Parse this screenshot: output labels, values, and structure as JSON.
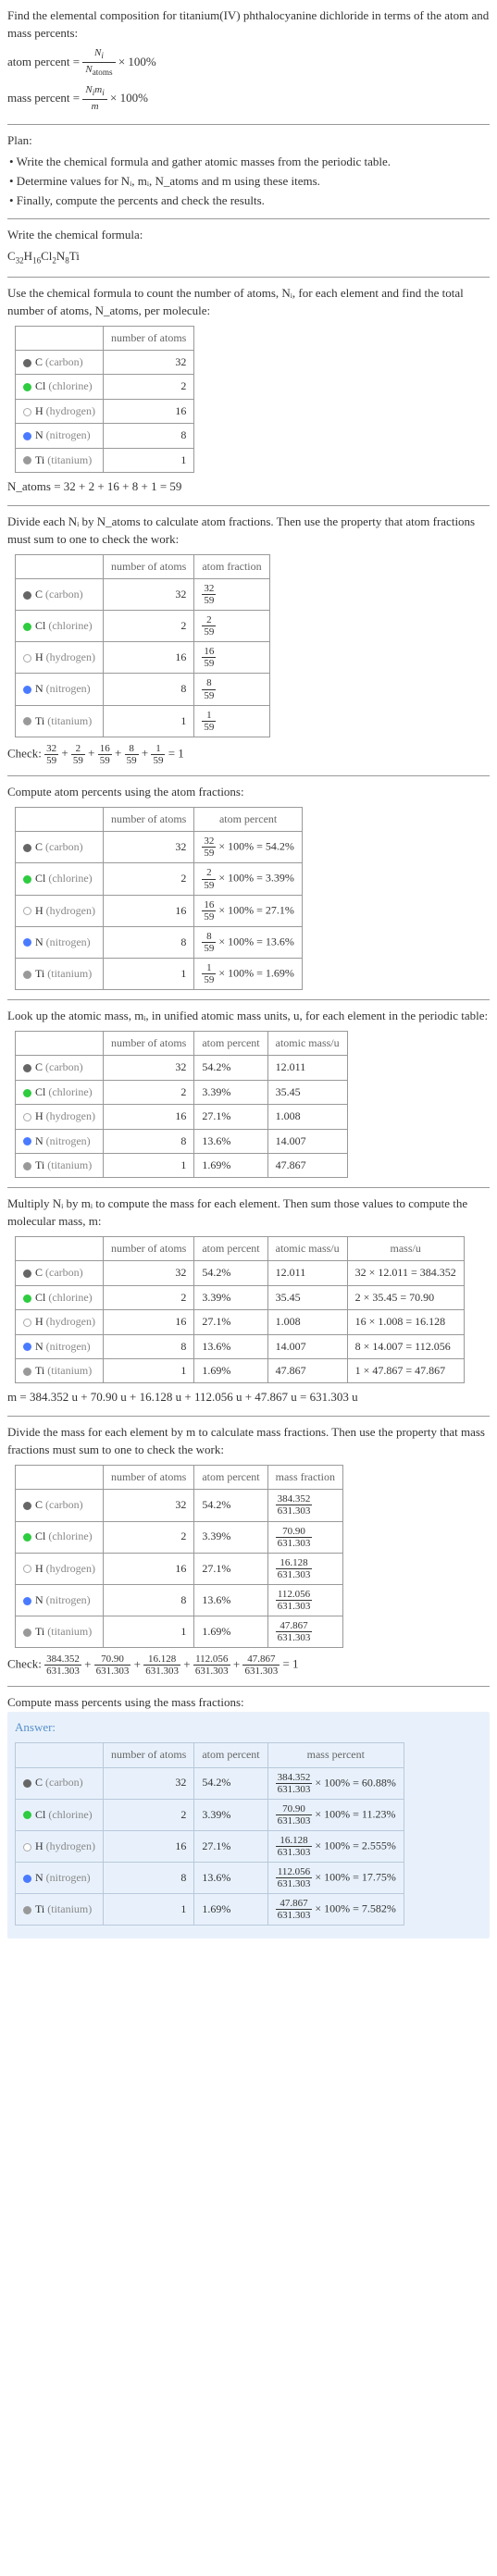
{
  "intro": "Find the elemental composition for titanium(IV) phthalocyanine dichloride in terms of the atom and mass percents:",
  "atom_percent_label": "atom percent",
  "mass_percent_label": "mass percent",
  "times_100": "× 100%",
  "plan_title": "Plan:",
  "plan_items": [
    "• Write the chemical formula and gather atomic masses from the periodic table.",
    "• Determine values for Nᵢ, mᵢ, N_atoms and m using these items.",
    "• Finally, compute the percents and check the results."
  ],
  "write_formula_label": "Write the chemical formula:",
  "chem_formula_parts": [
    "C",
    "32",
    "H",
    "16",
    "Cl",
    "2",
    "N",
    "8",
    "Ti"
  ],
  "use_formula_text": "Use the chemical formula to count the number of atoms, Nᵢ, for each element and find the total number of atoms, N_atoms, per molecule:",
  "headers": {
    "num_atoms": "number of atoms",
    "atom_frac": "atom fraction",
    "atom_pct": "atom percent",
    "mass_u": "atomic mass/u",
    "mass": "mass/u",
    "mass_frac": "mass fraction",
    "mass_pct": "mass percent"
  },
  "elements": [
    {
      "dot": "dot-c",
      "sym": "C",
      "name": "(carbon)",
      "n": "32",
      "frac": "32/59",
      "pct": "54.2%",
      "mu": "12.011",
      "massmul": "32 × 12.011 = 384.352",
      "mfrac": "384.352/631.303",
      "mpct": "60.88%",
      "pct_expr": "32/59 × 100% = 54.2%"
    },
    {
      "dot": "dot-cl",
      "sym": "Cl",
      "name": "(chlorine)",
      "n": "2",
      "frac": "2/59",
      "pct": "3.39%",
      "mu": "35.45",
      "massmul": "2 × 35.45 = 70.90",
      "mfrac": "70.90/631.303",
      "mpct": "11.23%",
      "pct_expr": "2/59 × 100% = 3.39%"
    },
    {
      "dot": "dot-h",
      "sym": "H",
      "name": "(hydrogen)",
      "n": "16",
      "frac": "16/59",
      "pct": "27.1%",
      "mu": "1.008",
      "massmul": "16 × 1.008 = 16.128",
      "mfrac": "16.128/631.303",
      "mpct": "2.555%",
      "pct_expr": "16/59 × 100% = 27.1%"
    },
    {
      "dot": "dot-n",
      "sym": "N",
      "name": "(nitrogen)",
      "n": "8",
      "frac": "8/59",
      "pct": "13.6%",
      "mu": "14.007",
      "massmul": "8 × 14.007 = 112.056",
      "mfrac": "112.056/631.303",
      "mpct": "17.75%",
      "pct_expr": "8/59 × 100% = 13.6%"
    },
    {
      "dot": "dot-ti",
      "sym": "Ti",
      "name": "(titanium)",
      "n": "1",
      "frac": "1/59",
      "pct": "1.69%",
      "mu": "47.867",
      "massmul": "1 × 47.867 = 47.867",
      "mfrac": "47.867/631.303",
      "mpct": "7.582%",
      "pct_expr": "1/59 × 100% = 1.69%"
    }
  ],
  "n_atoms_eq": "N_atoms = 32 + 2 + 16 + 8 + 1 = 59",
  "atom_frac_text": "Divide each Nᵢ by N_atoms to calculate atom fractions. Then use the property that atom fractions must sum to one to check the work:",
  "check_label": "Check:",
  "atom_frac_check": "32/59 + 2/59 + 16/59 + 8/59 + 1/59 = 1",
  "atom_pct_text": "Compute atom percents using the atom fractions:",
  "mass_lookup_text": "Look up the atomic mass, mᵢ, in unified atomic mass units, u, for each element in the periodic table:",
  "mass_mult_text": "Multiply Nᵢ by mᵢ to compute the mass for each element. Then sum those values to compute the molecular mass, m:",
  "m_eq": "m = 384.352 u + 70.90 u + 16.128 u + 112.056 u + 47.867 u = 631.303 u",
  "mass_frac_text": "Divide the mass for each element by m to calculate mass fractions. Then use the property that mass fractions must sum to one to check the work:",
  "mass_frac_check": "384.352/631.303 + 70.90/631.303 + 16.128/631.303 + 112.056/631.303 + 47.867/631.303 = 1",
  "mass_pct_text": "Compute mass percents using the mass fractions:",
  "answer_label": "Answer:",
  "answer_rows": [
    {
      "dot": "dot-c",
      "sym": "C",
      "name": "(carbon)",
      "n": "32",
      "pct": "54.2%",
      "num": "384.352",
      "mpct": "60.88%"
    },
    {
      "dot": "dot-cl",
      "sym": "Cl",
      "name": "(chlorine)",
      "n": "2",
      "pct": "3.39%",
      "num": "70.90",
      "mpct": "11.23%"
    },
    {
      "dot": "dot-h",
      "sym": "H",
      "name": "(hydrogen)",
      "n": "16",
      "pct": "27.1%",
      "num": "16.128",
      "mpct": "2.555%"
    },
    {
      "dot": "dot-n",
      "sym": "N",
      "name": "(nitrogen)",
      "n": "8",
      "pct": "13.6%",
      "num": "112.056",
      "mpct": "17.75%"
    },
    {
      "dot": "dot-ti",
      "sym": "Ti",
      "name": "(titanium)",
      "n": "1",
      "pct": "1.69%",
      "num": "47.867",
      "mpct": "7.582%"
    }
  ],
  "den": "631.303",
  "x100": "× 100% ="
}
